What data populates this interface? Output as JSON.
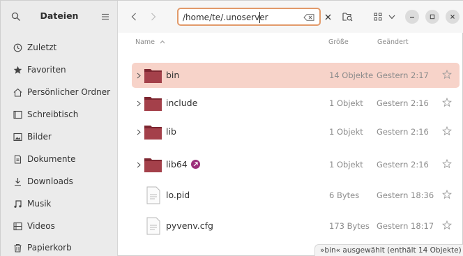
{
  "sidebar": {
    "title": "Dateien",
    "items": [
      {
        "label": "Zuletzt",
        "icon": "clock-icon"
      },
      {
        "label": "Favoriten",
        "icon": "star-icon"
      },
      {
        "label": "Persönlicher Ordner",
        "icon": "home-icon"
      },
      {
        "label": "Schreibtisch",
        "icon": "desktop-icon"
      },
      {
        "label": "Bilder",
        "icon": "image-icon"
      },
      {
        "label": "Dokumente",
        "icon": "document-icon"
      },
      {
        "label": "Downloads",
        "icon": "download-icon"
      },
      {
        "label": "Musik",
        "icon": "music-icon"
      },
      {
        "label": "Videos",
        "icon": "video-icon"
      },
      {
        "label": "Papierkorb",
        "icon": "trash-icon"
      }
    ]
  },
  "header": {
    "path_value": "/home/te/.unoserver"
  },
  "columns": {
    "name": "Name",
    "size": "Größe",
    "modified": "Geändert"
  },
  "files": [
    {
      "name": "bin",
      "size": "14 Objekte",
      "modified": "Gestern 2:17",
      "type": "folder",
      "selected": true
    },
    {
      "name": "include",
      "size": "1 Objekt",
      "modified": "Gestern 2:16",
      "type": "folder",
      "selected": false
    },
    {
      "name": "lib",
      "size": "1 Objekt",
      "modified": "Gestern 2:16",
      "type": "folder",
      "selected": false
    },
    {
      "name": "lib64",
      "size": "1 Objekt",
      "modified": "Gestern 2:16",
      "type": "folder-link",
      "selected": false
    },
    {
      "name": "lo.pid",
      "size": "6 Bytes",
      "modified": "Gestern 18:36",
      "type": "file",
      "selected": false
    },
    {
      "name": "pyvenv.cfg",
      "size": "173 Bytes",
      "modified": "Gestern 18:17",
      "type": "file",
      "selected": false
    }
  ],
  "status": "»bin« ausgewählt (enthält 14 Objekte)",
  "colors": {
    "accent": "#e29a6a",
    "selection": "#f7d3c9",
    "folder": "#a4404a",
    "badge": "#9c2f7a"
  }
}
